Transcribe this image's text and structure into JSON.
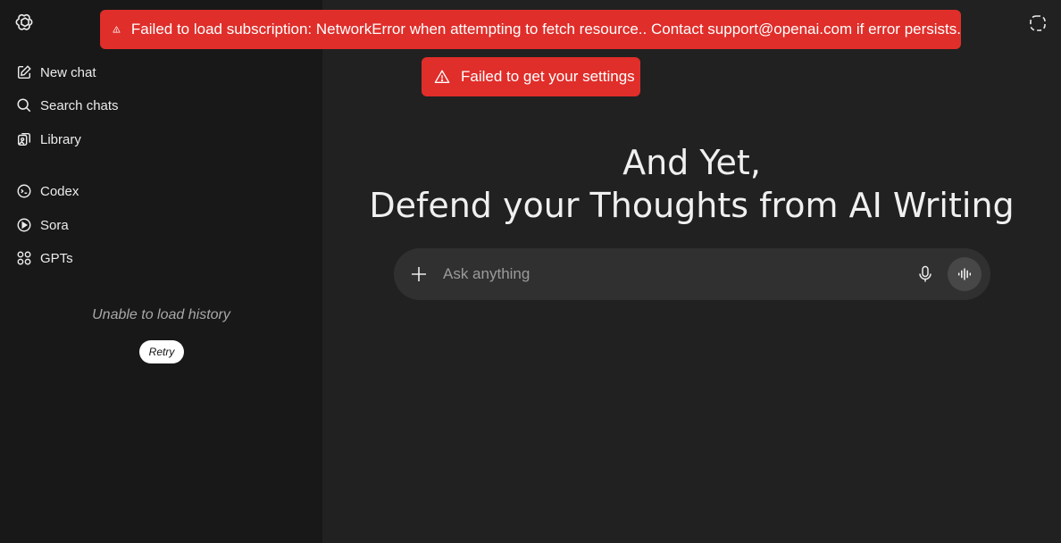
{
  "sidebar": {
    "items": [
      {
        "label": "New chat",
        "icon": "edit-icon"
      },
      {
        "label": "Search chats",
        "icon": "search-icon"
      },
      {
        "label": "Library",
        "icon": "library-icon"
      },
      {
        "label": "Codex",
        "icon": "codex-icon"
      },
      {
        "label": "Sora",
        "icon": "play-icon"
      },
      {
        "label": "GPTs",
        "icon": "grid-icon"
      }
    ],
    "history_error": "Unable to load history",
    "retry_label": "Retry"
  },
  "toasts": {
    "subscription_error": "Failed to load subscription: NetworkError when attempting to fetch resource.. Contact support@openai.com if error persists.",
    "settings_error": "Failed to get your settings"
  },
  "main": {
    "headline_line1": "And Yet,",
    "headline_line2": "Defend your Thoughts from AI Writing",
    "composer_placeholder": "Ask anything"
  },
  "colors": {
    "toast_bg": "#e02e2a",
    "sidebar_bg": "#181818",
    "main_bg": "#212121",
    "composer_bg": "#303030"
  }
}
